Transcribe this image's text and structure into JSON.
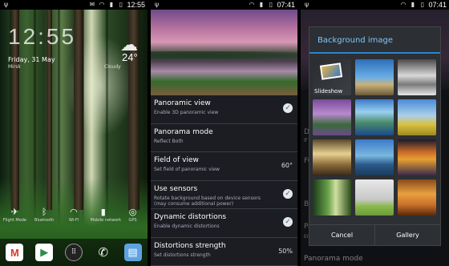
{
  "panel1": {
    "status_time": "12:55",
    "clock": "12:55",
    "date": "Friday, 31 May",
    "location": "Mirsk",
    "weather_condition": "Cloudy",
    "temperature": "24°",
    "toggles": [
      {
        "icon": "airplane-icon",
        "glyph": "✈",
        "label": "Flight Mode"
      },
      {
        "icon": "bluetooth-icon",
        "glyph": "ᛒ",
        "label": "Bluetooth"
      },
      {
        "icon": "wifi-icon",
        "glyph": "◠",
        "label": "Wi-Fi"
      },
      {
        "icon": "mobile-network-icon",
        "glyph": "▮",
        "label": "Mobile network"
      },
      {
        "icon": "gps-icon",
        "glyph": "◎",
        "label": "GPS"
      }
    ],
    "dock": [
      {
        "icon": "gmail-icon",
        "glyph": "M"
      },
      {
        "icon": "play-store-icon",
        "glyph": "▶"
      },
      {
        "icon": "all-apps-icon",
        "glyph": "⠿"
      },
      {
        "icon": "phone-icon",
        "glyph": "✆"
      },
      {
        "icon": "contacts-icon",
        "glyph": "▤"
      }
    ]
  },
  "panel2": {
    "status_time": "07:41",
    "settings": [
      {
        "title": "Panoramic view",
        "subtitle": "Enable 3D panoramic view",
        "value": "",
        "checked": true
      },
      {
        "title": "Panorama mode",
        "subtitle": "Reflect Both",
        "value": "",
        "checked": false
      },
      {
        "title": "Field of view",
        "subtitle": "Set field of panoramic view",
        "value": "60°",
        "checked": false
      },
      {
        "title": "Use sensors",
        "subtitle": "Rotate background based on device sensors (may consume additional power)",
        "value": "",
        "checked": true
      },
      {
        "title": "Dynamic distortions",
        "subtitle": "Enable dynamic distortions",
        "value": "",
        "checked": true
      },
      {
        "title": "Distortions strength",
        "subtitle": "Set distortions strength",
        "value": "50%",
        "checked": false
      }
    ]
  },
  "panel3": {
    "status_time": "07:41",
    "dialog_title": "Background image",
    "slideshow_label": "Slideshow",
    "cancel_label": "Cancel",
    "gallery_label": "Gallery",
    "background_setting": "Panorama mode",
    "faded_labels": [
      "Do",
      "If y",
      "Fu",
      "Ba",
      "Pa",
      "En"
    ]
  }
}
